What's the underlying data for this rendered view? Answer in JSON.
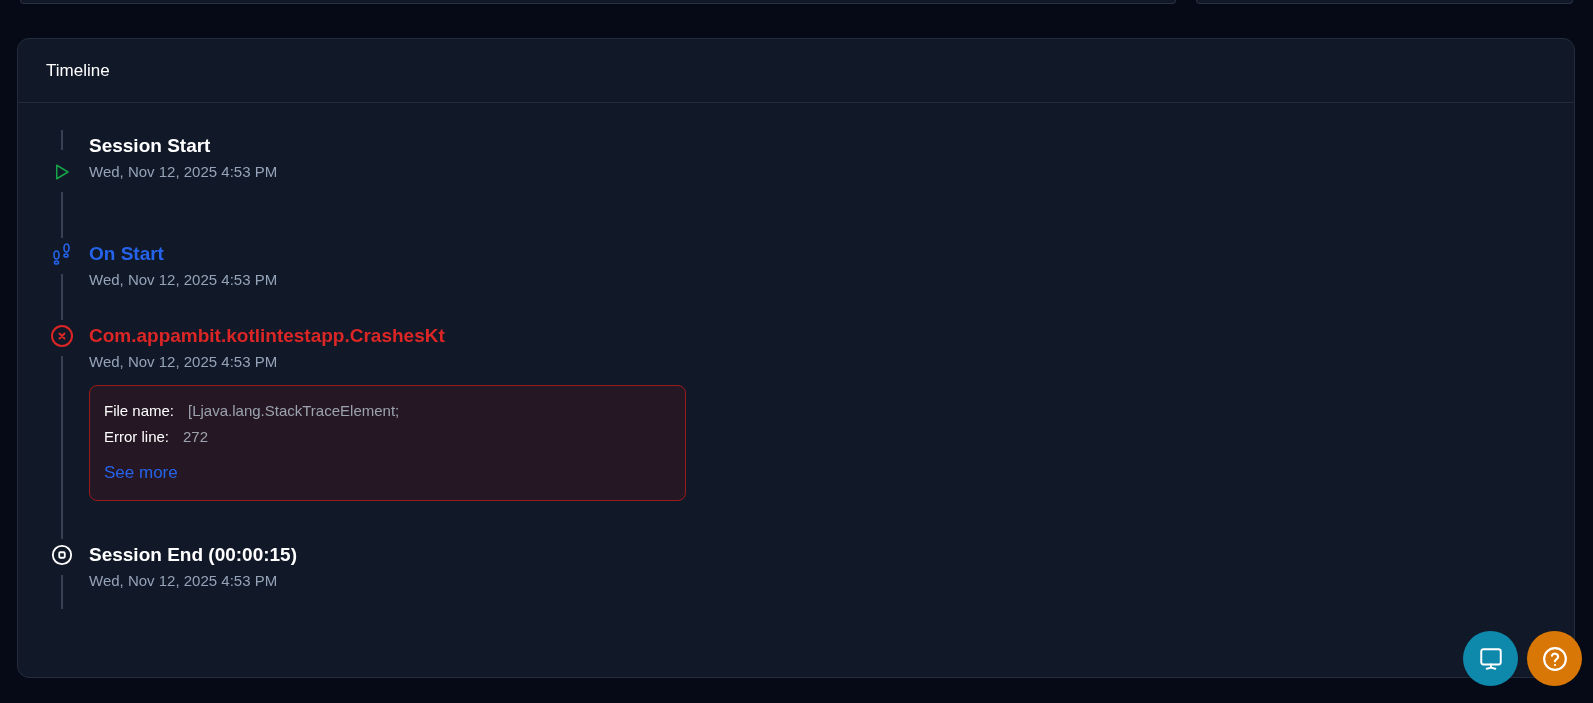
{
  "card": {
    "title": "Timeline"
  },
  "events": [
    {
      "kind": "start",
      "title": "Session Start",
      "time": "Wed, Nov 12, 2025 4:53 PM"
    },
    {
      "kind": "event",
      "title": "On Start",
      "time": "Wed, Nov 12, 2025 4:53 PM"
    },
    {
      "kind": "crash",
      "title": "Com.appambit.kotlintestapp.CrashesKt",
      "time": "Wed, Nov 12, 2025 4:53 PM",
      "details": [
        {
          "label": "File name:",
          "value": "[Ljava.lang.StackTraceElement;"
        },
        {
          "label": "Error line:",
          "value": "272"
        }
      ],
      "link": "See more"
    },
    {
      "kind": "end",
      "title": "Session End (00:00:15)",
      "time": "Wed, Nov 12, 2025 4:53 PM"
    }
  ]
}
